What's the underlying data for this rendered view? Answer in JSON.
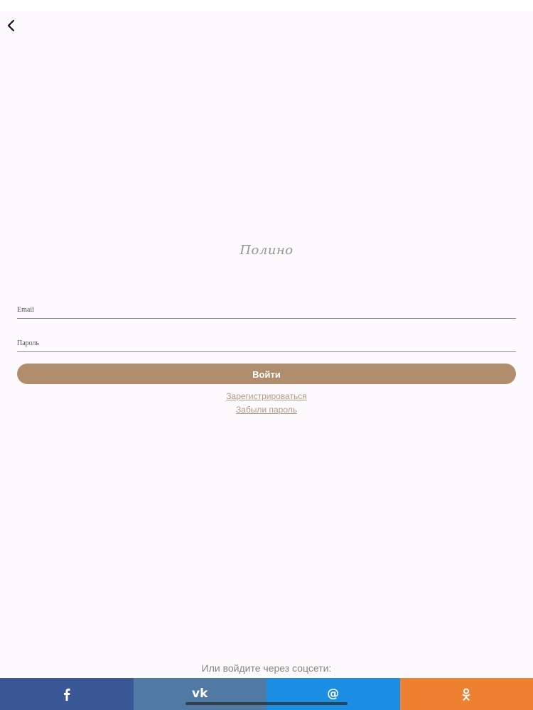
{
  "navigation": {
    "back_icon": "chevron-left-icon"
  },
  "brand": {
    "logo_text": "Полино"
  },
  "form": {
    "email": {
      "value": "",
      "placeholder": "Email"
    },
    "password": {
      "value": "",
      "placeholder": "Пароль"
    },
    "submit_label": "Войти",
    "register_link": "Зарегистрироваться",
    "forgot_link": "Забыли пароль"
  },
  "social": {
    "caption": "Или войдите через соцсети:",
    "providers": [
      {
        "id": "facebook",
        "icon": "facebook-icon",
        "glyph": "f",
        "color": "#3a5796"
      },
      {
        "id": "vk",
        "icon": "vk-icon",
        "glyph": "vk",
        "color": "#5079a3"
      },
      {
        "id": "mail",
        "icon": "at-sign-icon",
        "glyph": "@",
        "color": "#1b8de2"
      },
      {
        "id": "odnoklassniki",
        "icon": "odnoklassniki-icon",
        "glyph": "ok",
        "color": "#ee8131"
      }
    ]
  },
  "colors": {
    "background": "#fdfafd",
    "accent": "#b08e6d",
    "link": "#b29a82"
  }
}
